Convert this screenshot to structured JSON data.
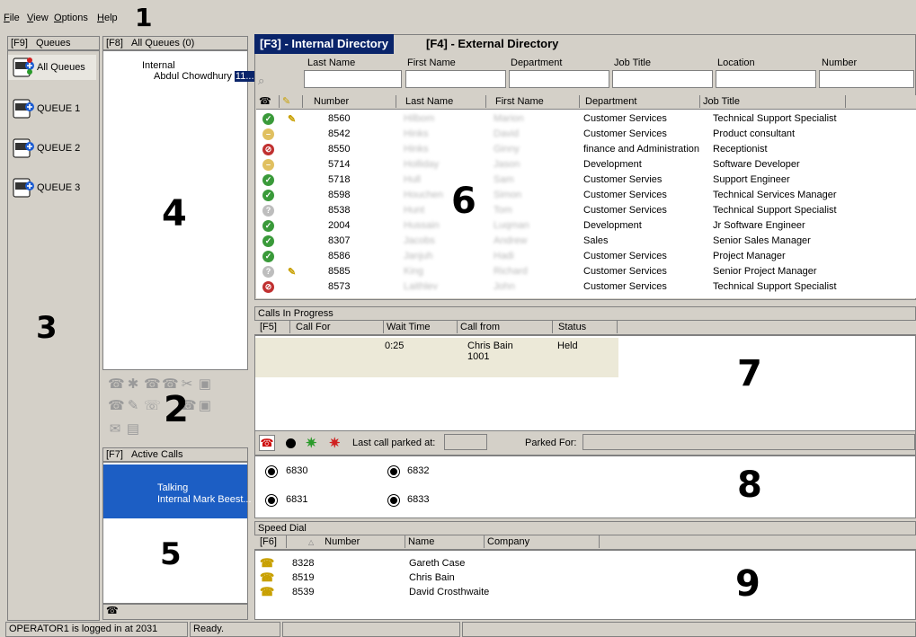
{
  "menu": {
    "file": "File",
    "view": "View",
    "options": "Options",
    "help": "Help"
  },
  "callouts": [
    "1",
    "2",
    "3",
    "4",
    "5",
    "6",
    "7",
    "8",
    "9"
  ],
  "queues": {
    "tab_key": "[F9]",
    "tab_label": "Queues",
    "items": [
      {
        "label": "All Queues",
        "icon": "all-queues-phone-icon"
      },
      {
        "label": "QUEUE 1",
        "icon": "queue-phone-icon"
      },
      {
        "label": "QUEUE 2",
        "icon": "queue-phone-icon"
      },
      {
        "label": "QUEUE 3",
        "icon": "queue-phone-icon"
      }
    ]
  },
  "queue_calls": {
    "tab_key": "[F8]",
    "tab_label": "All Queues (0)",
    "call_type": "Internal",
    "caller": "Abdul Chowdhury",
    "caller_tag": "11..."
  },
  "active_calls": {
    "tab_key": "[F7]",
    "tab_label": "Active Calls",
    "state": "Talking",
    "party": "Internal Mark Beest..."
  },
  "directory": {
    "tab_internal": "[F3] - Internal Directory",
    "tab_external": "[F4] - External Directory",
    "search_labels": [
      "Last Name",
      "First Name",
      "Department",
      "Job Title",
      "Location",
      "Number"
    ],
    "columns": [
      "Number",
      "Last Name",
      "First Name",
      "Department",
      "Job Title"
    ],
    "rows": [
      {
        "status": "available",
        "note": true,
        "number": "8560",
        "last": "Hilbom",
        "first": "Marion",
        "dept": "Customer Services",
        "title": "Technical Support Specialist"
      },
      {
        "status": "busy",
        "note": false,
        "number": "8542",
        "last": "Hinks",
        "first": "David",
        "dept": "Customer Services",
        "title": "Product consultant"
      },
      {
        "status": "dnd",
        "note": false,
        "number": "8550",
        "last": "Hinks",
        "first": "Ginny",
        "dept": "finance and Administration",
        "title": "Receptionist"
      },
      {
        "status": "busy",
        "note": false,
        "number": "5714",
        "last": "Holliday",
        "first": "Jason",
        "dept": "Development",
        "title": "Software Developer"
      },
      {
        "status": "available",
        "note": false,
        "number": "5718",
        "last": "Hull",
        "first": "Sam",
        "dept": "Customer Servies",
        "title": "Support Engineer"
      },
      {
        "status": "available",
        "note": false,
        "number": "8598",
        "last": "Houchen",
        "first": "Simon",
        "dept": "Customer Services",
        "title": "Technical Services Manager"
      },
      {
        "status": "unknown",
        "note": false,
        "number": "8538",
        "last": "Hunt",
        "first": "Tom",
        "dept": "Customer Services",
        "title": "Technical Support Specialist"
      },
      {
        "status": "available",
        "note": false,
        "number": "2004",
        "last": "Hussain",
        "first": "Luqman",
        "dept": "Development",
        "title": "Jr Software Engineer"
      },
      {
        "status": "available",
        "note": false,
        "number": "8307",
        "last": "Jacobs",
        "first": "Andrew",
        "dept": "Sales",
        "title": "Senior Sales Manager"
      },
      {
        "status": "available",
        "note": false,
        "number": "8586",
        "last": "Janjuh",
        "first": "Hadi",
        "dept": "Customer Services",
        "title": "Project Manager"
      },
      {
        "status": "unknown",
        "note": true,
        "number": "8585",
        "last": "King",
        "first": "Richard",
        "dept": "Customer Services",
        "title": "Senior Project Manager"
      },
      {
        "status": "dnd",
        "note": false,
        "number": "8573",
        "last": "Laithlev",
        "first": "John",
        "dept": "Customer Services",
        "title": "Technical Support Specialist"
      }
    ]
  },
  "calls_in_progress": {
    "title": "Calls In Progress",
    "columns": [
      "[F5]",
      "Call For",
      "Wait Time",
      "Call from",
      "Status"
    ],
    "rows": [
      {
        "call_for": "",
        "wait": "0:25",
        "from": "Chris Bain",
        "from_ext": "1001",
        "status": "Held"
      }
    ]
  },
  "park": {
    "last_parked_label": "Last call parked at:",
    "parked_for_label": "Parked For:",
    "orbits": [
      "6830",
      "6832",
      "6831",
      "6833"
    ]
  },
  "speed_dial": {
    "title": "Speed Dial",
    "columns": [
      "[F6]",
      "Number",
      "Name",
      "Company"
    ],
    "rows": [
      {
        "number": "8328",
        "name": "Gareth Case",
        "company": ""
      },
      {
        "number": "8519",
        "name": "Chris Bain",
        "company": ""
      },
      {
        "number": "8539",
        "name": "David Crosthwaite",
        "company": ""
      }
    ]
  },
  "statusbar": {
    "login": "OPERATOR1 is logged in at 2031",
    "state": "Ready."
  },
  "colors": {
    "tab_active": "#0a246a",
    "selection": "#1c5ec4",
    "call_bg": "#ece9d8",
    "available": "#3a9a3a",
    "busy": "#e0c060",
    "dnd": "#c03030",
    "unknown": "#a0a0a0"
  }
}
